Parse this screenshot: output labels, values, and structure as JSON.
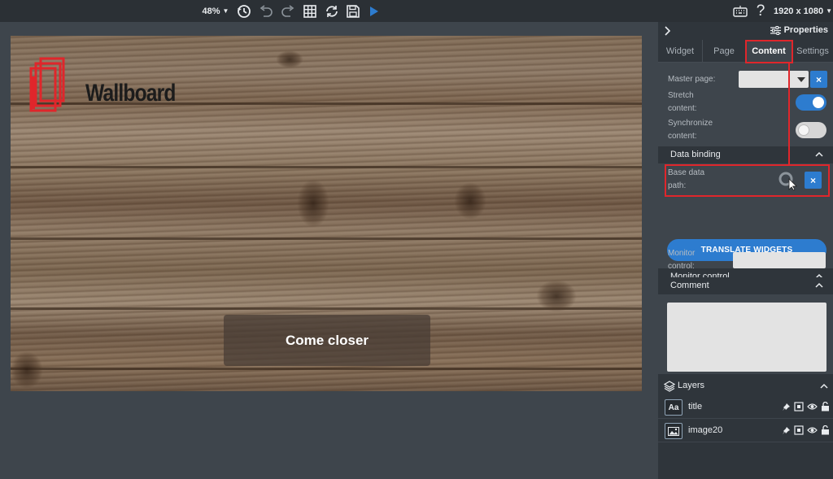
{
  "toolbar": {
    "zoom": "48%",
    "resolution": "1920 x 1080"
  },
  "canvas": {
    "logo_text": "Wallboard",
    "caption": "Come closer"
  },
  "panel": {
    "title": "Properties",
    "tabs": [
      {
        "label": "Widget",
        "active": false
      },
      {
        "label": "Page",
        "active": false
      },
      {
        "label": "Content",
        "active": true
      },
      {
        "label": "Settings",
        "active": false
      }
    ],
    "master_page_label": "Master page:",
    "master_page_value": "",
    "stretch_label_1": "Stretch",
    "stretch_label_2": "content:",
    "stretch_on": true,
    "sync_label_1": "Synchronize",
    "sync_label_2": "content:",
    "sync_on": false,
    "data_binding_title": "Data binding",
    "base_path_label_1": "Base data",
    "base_path_label_2": "path:",
    "translate_button": "TRANSLATE WIDGETS",
    "monitor_section_title": "Monitor control",
    "monitor_label_1": "Monitor",
    "monitor_label_2": "control:",
    "monitor_value": "",
    "comment_title": "Comment",
    "comment_value": "",
    "clear_symbol": "×"
  },
  "layers": {
    "title": "Layers",
    "items": [
      {
        "name": "title",
        "thumb": "Aa",
        "icon": "text-layer-icon"
      },
      {
        "name": "image20",
        "thumb": "",
        "icon": "image-layer-icon"
      }
    ]
  },
  "colors": {
    "accent": "#2d7ccf",
    "highlight": "#e0262b",
    "panel_bg": "#2f353b",
    "content_bg": "#3e454c"
  }
}
